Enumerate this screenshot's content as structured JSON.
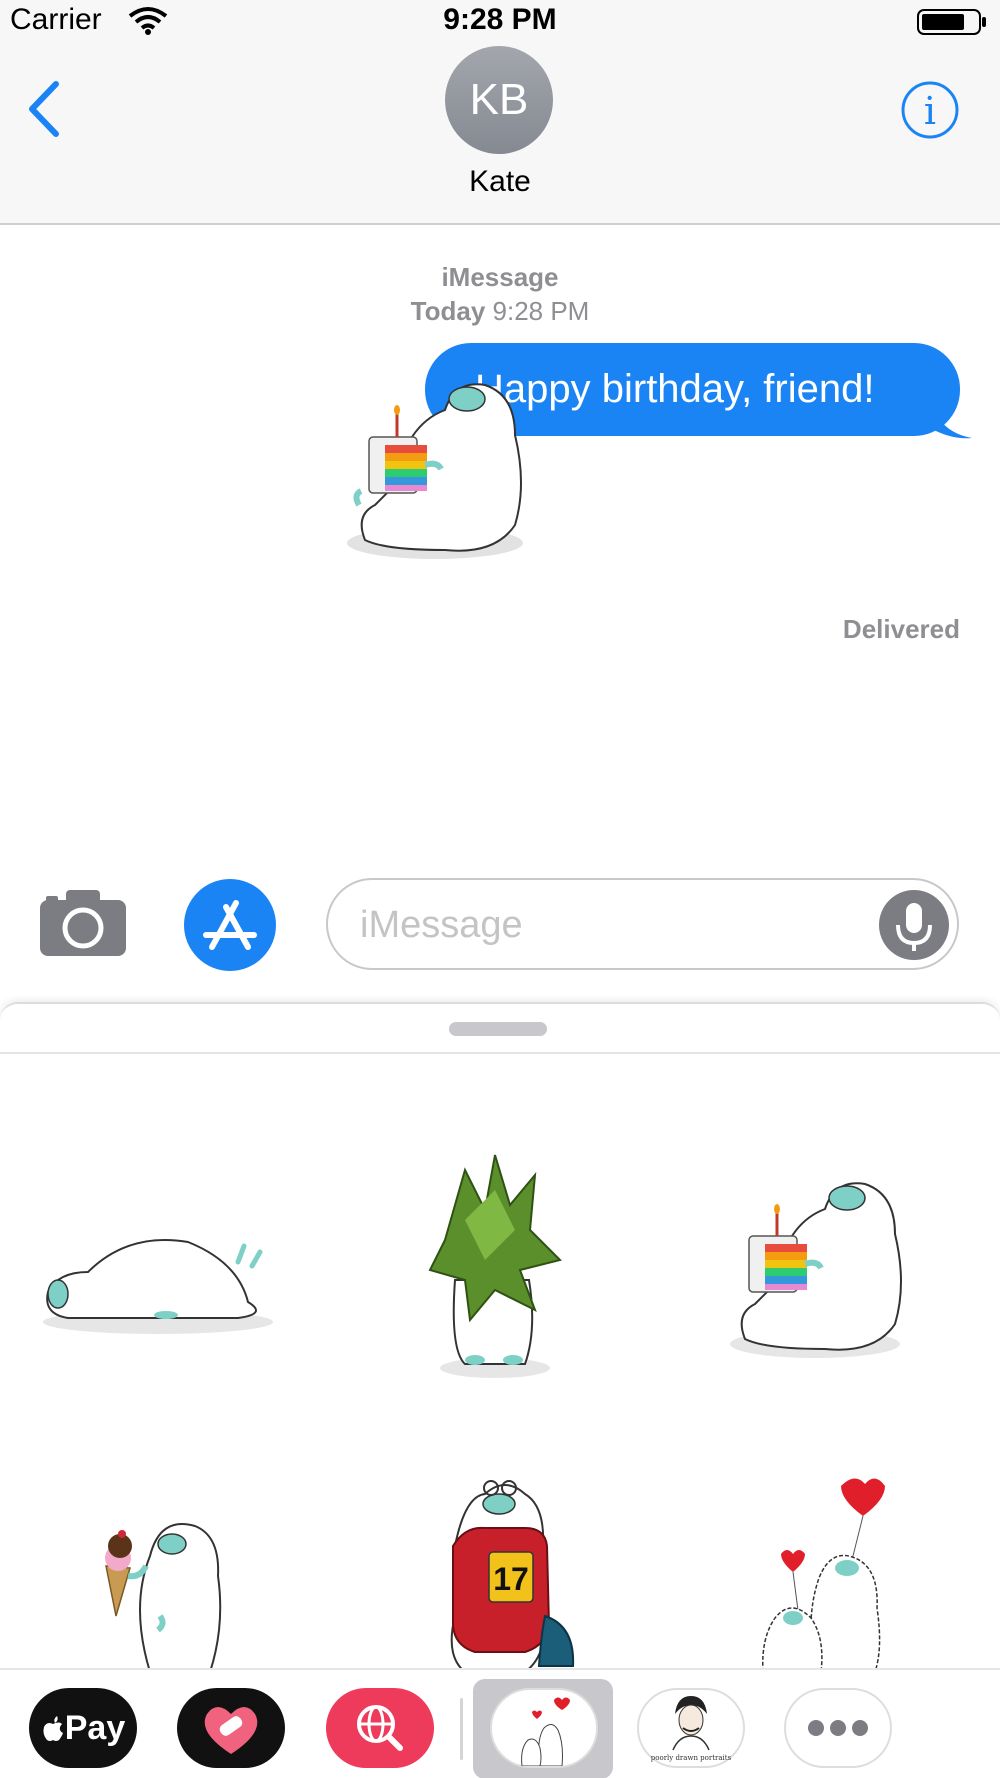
{
  "status_bar": {
    "carrier": "Carrier",
    "time": "9:28 PM"
  },
  "header": {
    "avatar_initials": "KB",
    "contact_name": "Kate",
    "back_icon": "chevron-left-icon",
    "info_icon": "info-icon"
  },
  "conversation": {
    "service_label": "iMessage",
    "timestamp_day": "Today",
    "timestamp_time": "9:28 PM",
    "message_text": "Happy birthday, friend!",
    "delivery_status": "Delivered"
  },
  "input": {
    "placeholder": "iMessage",
    "camera_icon": "camera-icon",
    "apps_icon": "app-store-icon",
    "mic_icon": "microphone-icon"
  },
  "stickers": [
    {
      "name": "yeti-lying-down"
    },
    {
      "name": "yeti-behind-leaves"
    },
    {
      "name": "yeti-birthday-cake"
    },
    {
      "name": "yeti-ice-cream"
    },
    {
      "name": "yeti-swimmer-17"
    },
    {
      "name": "yetis-heart-balloons"
    }
  ],
  "swimmer_number": "17",
  "dock": {
    "apple_pay_label": "Pay",
    "poe_caption": "poorly drawn portraits",
    "items": [
      "apple-pay",
      "digital-touch-heart",
      "image-search",
      "yeti-stickers",
      "poe-portraits",
      "more"
    ]
  },
  "colors": {
    "accent": "#1b84f5",
    "bubble": "#1b84f5",
    "secondary_text": "#8e8e93",
    "search_app": "#ee3b5b"
  }
}
